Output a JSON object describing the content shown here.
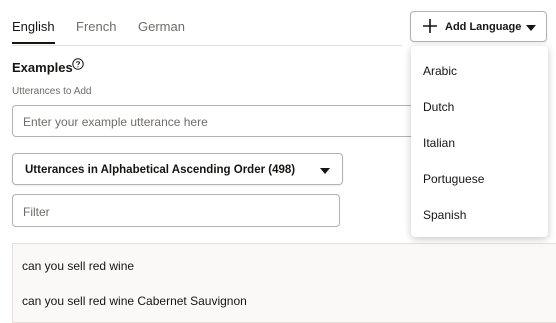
{
  "tabs": [
    {
      "label": "English",
      "active": true
    },
    {
      "label": "French",
      "active": false
    },
    {
      "label": "German",
      "active": false
    }
  ],
  "add_language": {
    "label": "Add Language",
    "icon": "plus-icon"
  },
  "examples": {
    "title": "Examples",
    "help_icon": "help-circle-icon",
    "utterances_label": "Utterances to Add",
    "utterance_placeholder": "Enter your example utterance here"
  },
  "sort": {
    "label": "Utterances in Alphabetical Ascending Order (498)"
  },
  "filter": {
    "placeholder": "Filter"
  },
  "utterances": [
    "can you sell red wine",
    "can you sell red wine Cabernet Sauvignon"
  ],
  "language_menu": [
    "Arabic",
    "Dutch",
    "Italian",
    "Portuguese",
    "Spanish"
  ]
}
